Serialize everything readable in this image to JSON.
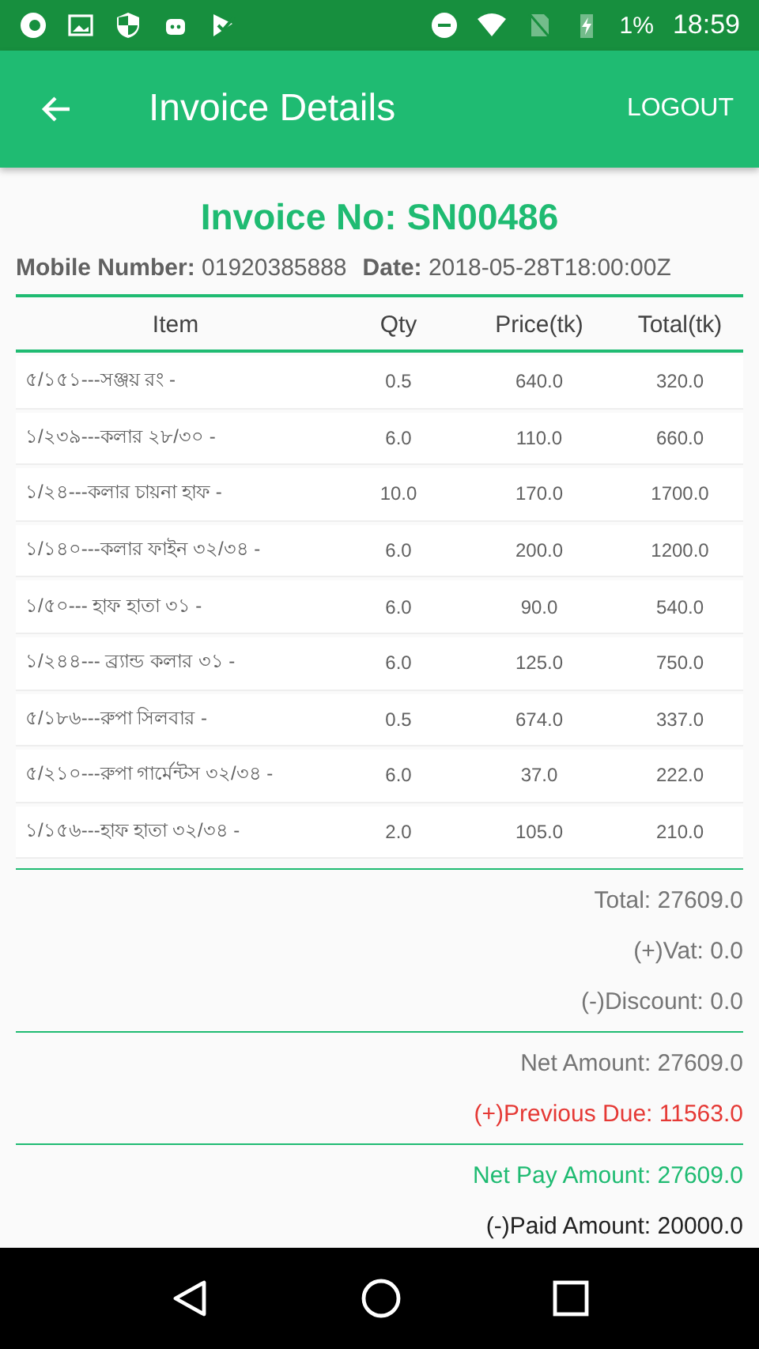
{
  "status_bar": {
    "battery": "1%",
    "time": "18:59"
  },
  "app_bar": {
    "title": "Invoice Details",
    "action": "LOGOUT"
  },
  "invoice": {
    "number": "Invoice No: SN00486",
    "mobile": "**Mobile Number:** 01920385888",
    "date": "**Date:** 2018-05-28T18:00:00Z"
  },
  "table": {
    "columns": [
      "Item",
      "Qty",
      "Price(tk)",
      "Total(tk)"
    ],
    "rows": [
      [
        "৫/১৫১---সঞ্জয় রং -",
        "0.5",
        "640.0",
        "320.0"
      ],
      [
        "১/২৩৯---কলার ২৮/৩০ -",
        "6.0",
        "110.0",
        "660.0"
      ],
      [
        "১/২৪---কলার চায়না  হাফ -",
        "10.0",
        "170.0",
        "1700.0"
      ],
      [
        "১/১৪০---কলার ফাইন ৩২/৩৪ -",
        "6.0",
        "200.0",
        "1200.0"
      ],
      [
        "১/৫০--- হাফ হাতা ৩১ -",
        "6.0",
        "90.0",
        "540.0"
      ],
      [
        "১/২৪৪--- ব্র্যান্ড কলার ৩১ -",
        "6.0",
        "125.0",
        "750.0"
      ],
      [
        "৫/১৮৬---রুপা সিলবার -",
        "0.5",
        "674.0",
        "337.0"
      ],
      [
        "৫/২১০---রুপা গার্মেন্টস ৩২/৩৪ -",
        "6.0",
        "37.0",
        "222.0"
      ],
      [
        "১/১৫৬---হাফ হাতা ৩২/৩৪ -",
        "2.0",
        "105.0",
        "210.0"
      ]
    ]
  },
  "summary": [
    [
      {
        "text": "Total: 27609.0",
        "color": "#757575"
      },
      {
        "text": "(+)Vat: 0.0",
        "color": "#757575"
      },
      {
        "text": "(-)Discount: 0.0",
        "color": "#757575"
      }
    ],
    [
      {
        "text": "Net Amount: 27609.0",
        "color": "#757575"
      },
      {
        "text": "(+)Previous Due: 11563.0",
        "color": "#e53935"
      }
    ],
    [
      {
        "text": "Net Pay Amount: 27609.0",
        "color": "#1fbb72"
      },
      {
        "text": "(-)Paid Amount: 20000.0",
        "color": "#212121"
      }
    ]
  ]
}
